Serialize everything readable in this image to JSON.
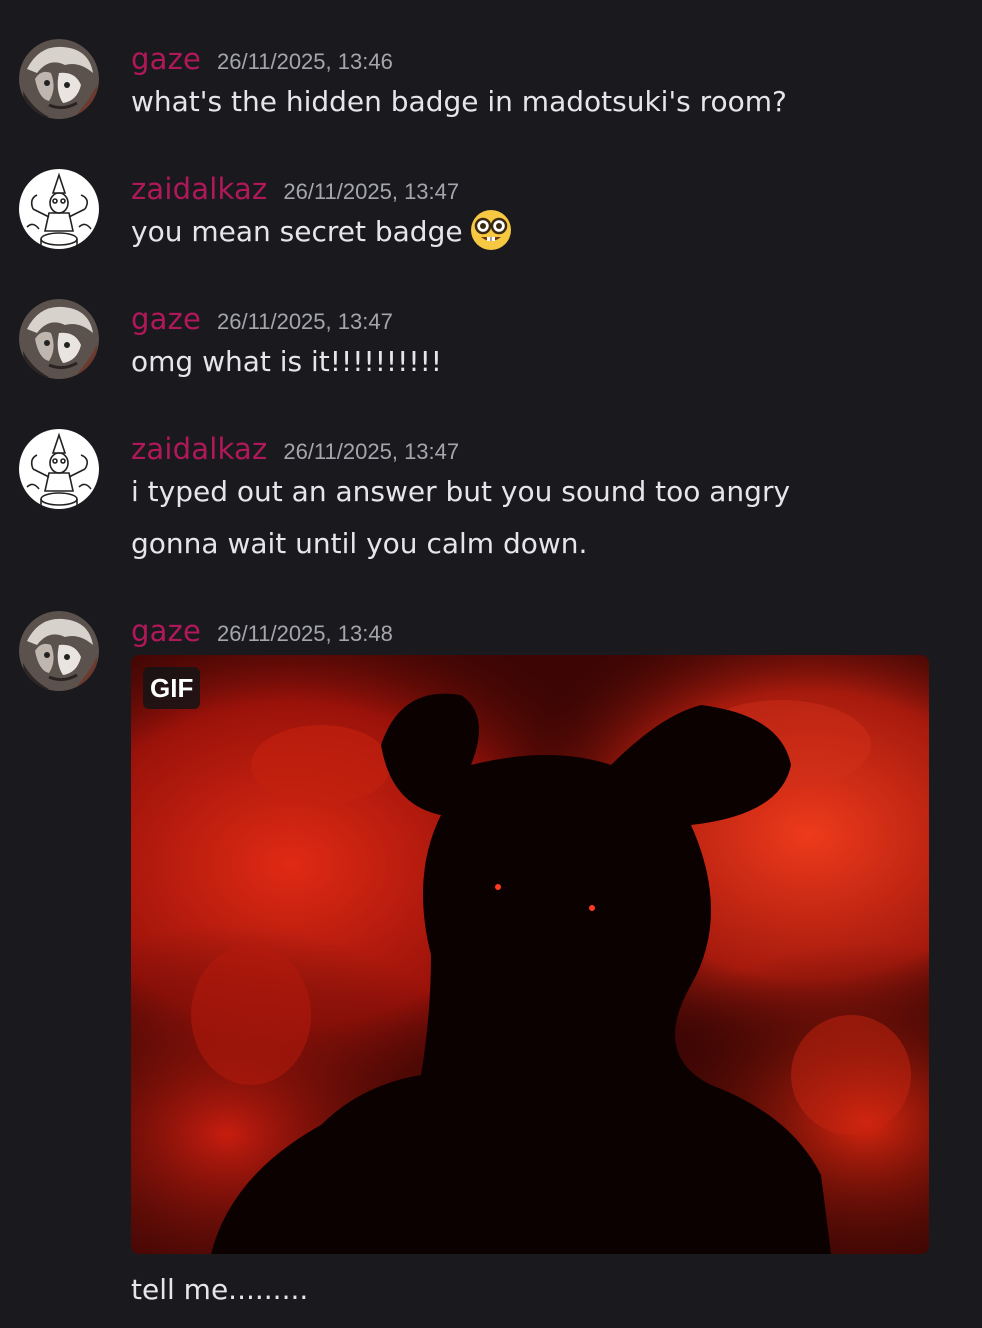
{
  "messages": [
    {
      "author": "gaze",
      "timestamp": "26/11/2025, 13:46",
      "lines": [
        "what's the hidden badge in madotsuki's room?"
      ]
    },
    {
      "author": "zaidalkaz",
      "timestamp": "26/11/2025, 13:47",
      "lines": [
        "you mean secret badge"
      ],
      "emoji": "nerd-face-icon"
    },
    {
      "author": "gaze",
      "timestamp": "26/11/2025, 13:47",
      "lines": [
        "omg what is it!!!!!!!!!!"
      ]
    },
    {
      "author": "zaidalkaz",
      "timestamp": "26/11/2025, 13:47",
      "lines": [
        "i typed out an answer but you sound too angry",
        "gonna wait until you calm down."
      ]
    },
    {
      "author": "gaze",
      "timestamp": "26/11/2025, 13:48",
      "attachment": {
        "badge": "GIF"
      },
      "lines": [
        "tell me........."
      ]
    }
  ],
  "colors": {
    "background": "#1a1a1e",
    "username": "#b0185a",
    "timestamp": "#a4a6ab",
    "text": "#e6e6e8"
  }
}
